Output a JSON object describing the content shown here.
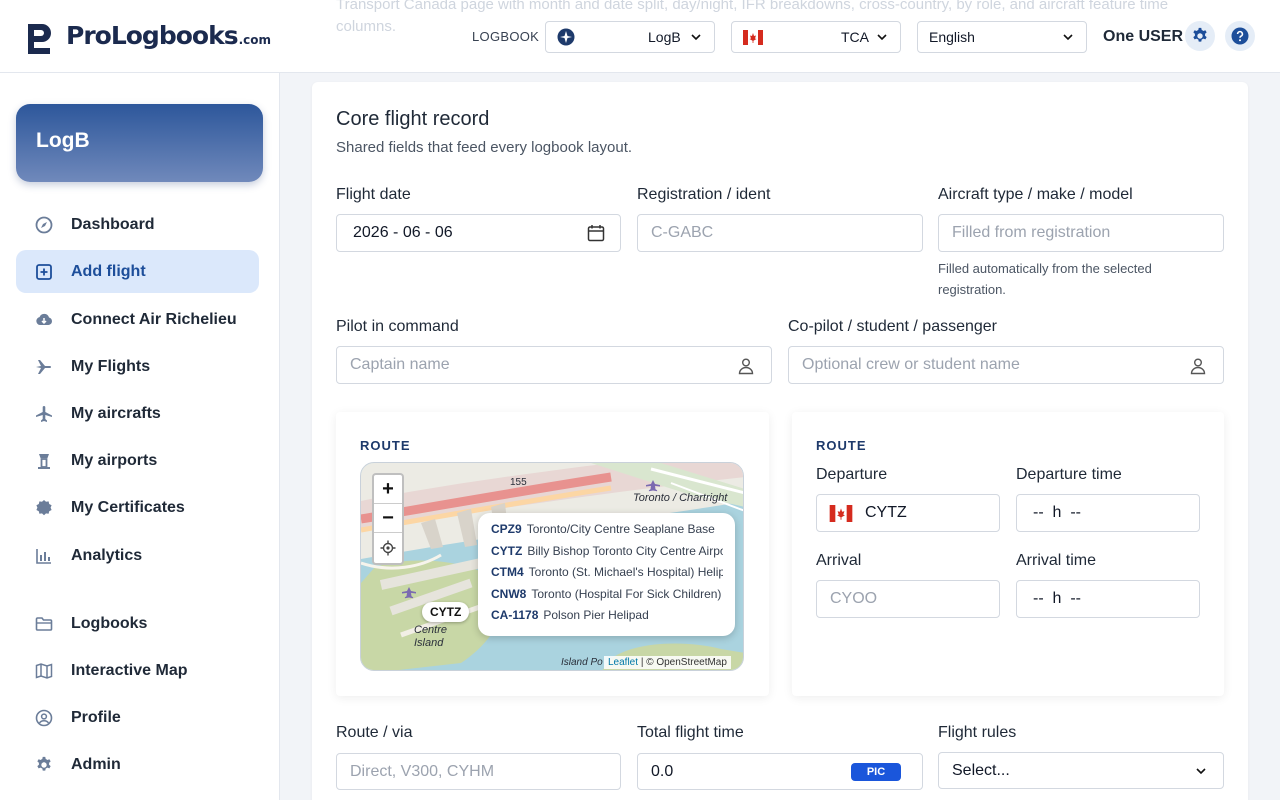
{
  "top": {
    "ghost_text": "Transport Canada page with month and date split, day/night, IFR breakdowns, cross-country, by role, and aircraft feature time columns.",
    "brand": "ProLogbooks",
    "brand_suffix": ".com",
    "logbook_label": "LOGBOOK",
    "logbook_value": "LogB",
    "authority_value": "TCA",
    "language_value": "English",
    "user_name": "One USER"
  },
  "sidebar": {
    "logbook_card": "LogB",
    "items": [
      {
        "label": "Dashboard",
        "icon": "compass-icon"
      },
      {
        "label": "Add flight",
        "icon": "plus-square-icon"
      },
      {
        "label": "Connect Air Richelieu",
        "icon": "cloud-download-icon"
      },
      {
        "label": "My Flights",
        "icon": "plane-icon"
      },
      {
        "label": "My aircrafts",
        "icon": "aircraft-icon"
      },
      {
        "label": "My airports",
        "icon": "tower-icon"
      },
      {
        "label": "My Certificates",
        "icon": "certificate-icon"
      },
      {
        "label": "Analytics",
        "icon": "bar-chart-icon"
      },
      {
        "label": "Logbooks",
        "icon": "folder-icon"
      },
      {
        "label": "Interactive Map",
        "icon": "map-icon"
      },
      {
        "label": "Profile",
        "icon": "user-circle-icon"
      },
      {
        "label": "Admin",
        "icon": "gear-icon"
      }
    ]
  },
  "form": {
    "title": "Core flight record",
    "subtitle": "Shared fields that feed every logbook layout.",
    "flight_date_label": "Flight date",
    "flight_date_value": "2026 - 06 - 06",
    "registration_label": "Registration / ident",
    "registration_placeholder": "C-GABC",
    "aircraft_type_label": "Aircraft type / make / model",
    "aircraft_type_placeholder": "Filled from registration",
    "aircraft_type_hint": "Filled automatically from the selected registration.",
    "pic_label": "Pilot in command",
    "pic_placeholder": "Captain name",
    "copilot_label": "Co-pilot / student / passenger",
    "copilot_placeholder": "Optional crew or student name",
    "route_via_label": "Route / via",
    "route_via_placeholder": "Direct, V300, CYHM",
    "total_time_label": "Total flight time",
    "total_time_value": "0.0",
    "total_time_badge": "PIC",
    "flight_rules_label": "Flight rules",
    "flight_rules_value": "Select..."
  },
  "route_map": {
    "tag": "ROUTE",
    "zoom_in": "+",
    "zoom_out": "−",
    "marker": "CYTZ",
    "place_labels": [
      "Toronto / Chartright",
      "Centre Island",
      "Island Po",
      "155"
    ],
    "attribution_link": "Leaflet",
    "attribution_text": "| © OpenStreetMap",
    "suggestions": [
      {
        "code": "CPZ9",
        "name": "Toronto/City Centre Seaplane Base"
      },
      {
        "code": "CYTZ",
        "name": "Billy Bishop Toronto City Centre Airport"
      },
      {
        "code": "CTM4",
        "name": "Toronto (St. Michael's Hospital) Heliport"
      },
      {
        "code": "CNW8",
        "name": "Toronto (Hospital For Sick Children) Heliport"
      },
      {
        "code": "CA-1178",
        "name": "Polson Pier Helipad"
      }
    ]
  },
  "route_fields": {
    "tag": "ROUTE",
    "departure_label": "Departure",
    "departure_value": "CYTZ",
    "departure_time_label": "Departure time",
    "departure_time_value": "--  h  --",
    "arrival_label": "Arrival",
    "arrival_placeholder": "CYOO",
    "arrival_time_label": "Arrival time",
    "arrival_time_value": "--  h  --"
  },
  "colors": {
    "primary": "#1d4e9a",
    "brand_navy": "#1b2a4e",
    "badge_blue": "#1a56db",
    "active_nav_bg": "#dbe8fb"
  }
}
